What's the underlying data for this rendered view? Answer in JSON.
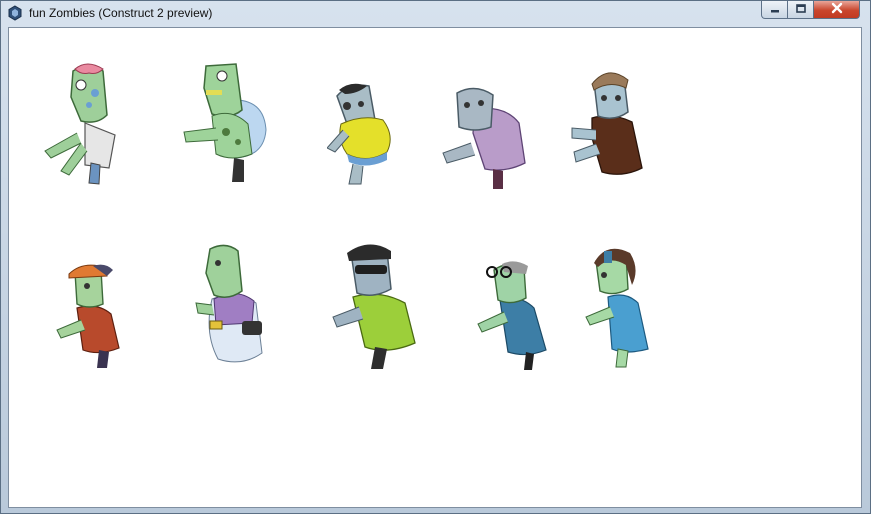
{
  "window": {
    "title": "fun Zombies (Construct 2 preview)",
    "icons": {
      "app": "construct-2-icon",
      "minimize": "minimize-icon",
      "maximize": "maximize-icon",
      "close": "close-icon"
    }
  },
  "canvas": {
    "background": "#ffffff",
    "sprites": [
      {
        "name": "zombie-brain-exposed",
        "shirt": "#e6e6e6",
        "skin": "#9ecf9a"
      },
      {
        "name": "zombie-big-green",
        "shirt": "#bcd7f0",
        "skin": "#9ed39a"
      },
      {
        "name": "zombie-yellow-shirt",
        "shirt": "#e4e02a",
        "skin": "#a9bdc6"
      },
      {
        "name": "zombie-purple-hoodie",
        "shirt": "#b99cc9",
        "skin": "#a9b8c4"
      },
      {
        "name": "zombie-brown-coat",
        "shirt": "#5a2e1a",
        "skin": "#a9c3d0"
      },
      {
        "name": "zombie-cap-kid",
        "shirt": "#b84a2c",
        "skin": "#a6d39c"
      },
      {
        "name": "zombie-tourist-camera",
        "shirt": "#a07ec3",
        "skin": "#9fd19b"
      },
      {
        "name": "zombie-green-jacket",
        "shirt": "#9ccf3a",
        "skin": "#9fb3c2"
      },
      {
        "name": "zombie-glasses-lady",
        "shirt": "#3d7ea6",
        "skin": "#9fd3a6"
      },
      {
        "name": "zombie-girl-blue-dress",
        "shirt": "#4a9fd0",
        "skin": "#a6d9a5"
      }
    ]
  }
}
